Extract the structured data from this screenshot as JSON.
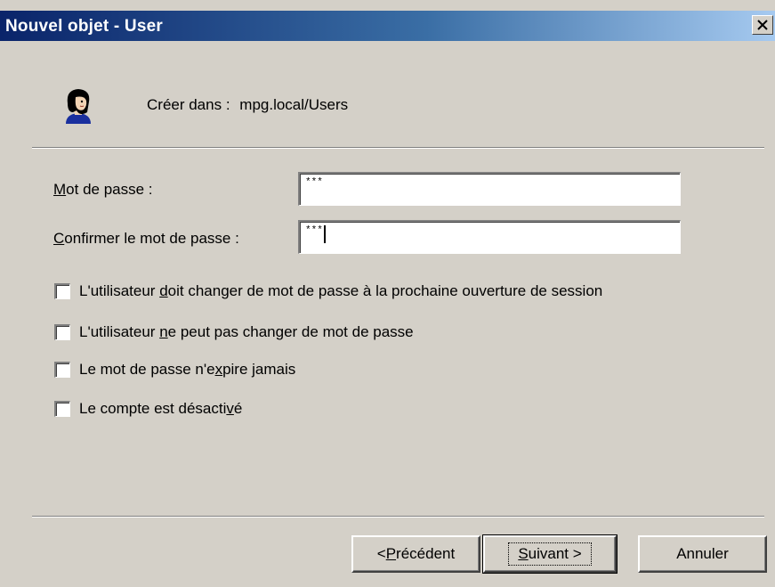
{
  "window": {
    "title": "Nouvel objet - User",
    "close_glyph": "close-icon"
  },
  "header": {
    "icon": "user-icon",
    "create_label": "Créer dans :",
    "create_path": "mpg.local/Users"
  },
  "form": {
    "password": {
      "label_mnemonic": "M",
      "label_rest": "ot de passe :",
      "value": "***"
    },
    "confirm": {
      "label_mnemonic": "C",
      "label_rest": "onfirmer le mot de passe :",
      "value": "***"
    }
  },
  "options": [
    {
      "pre": "L'utilisateur ",
      "mn": "d",
      "post": "oit changer de mot de passe à la prochaine ouverture de session",
      "checked": false
    },
    {
      "pre": "L'utilisateur ",
      "mn": "n",
      "post": "e peut pas changer de mot de passe",
      "checked": false
    },
    {
      "pre": "Le mot de passe n'e",
      "mn": "x",
      "post": "pire jamais",
      "checked": false
    },
    {
      "pre": "Le compte est désacti",
      "mn": "v",
      "post": "é",
      "checked": false
    }
  ],
  "buttons": {
    "back": {
      "pre": "< ",
      "mn": "P",
      "post": "récédent"
    },
    "next": {
      "pre": "",
      "mn": "S",
      "post": "uivant >"
    },
    "cancel": "Annuler"
  }
}
